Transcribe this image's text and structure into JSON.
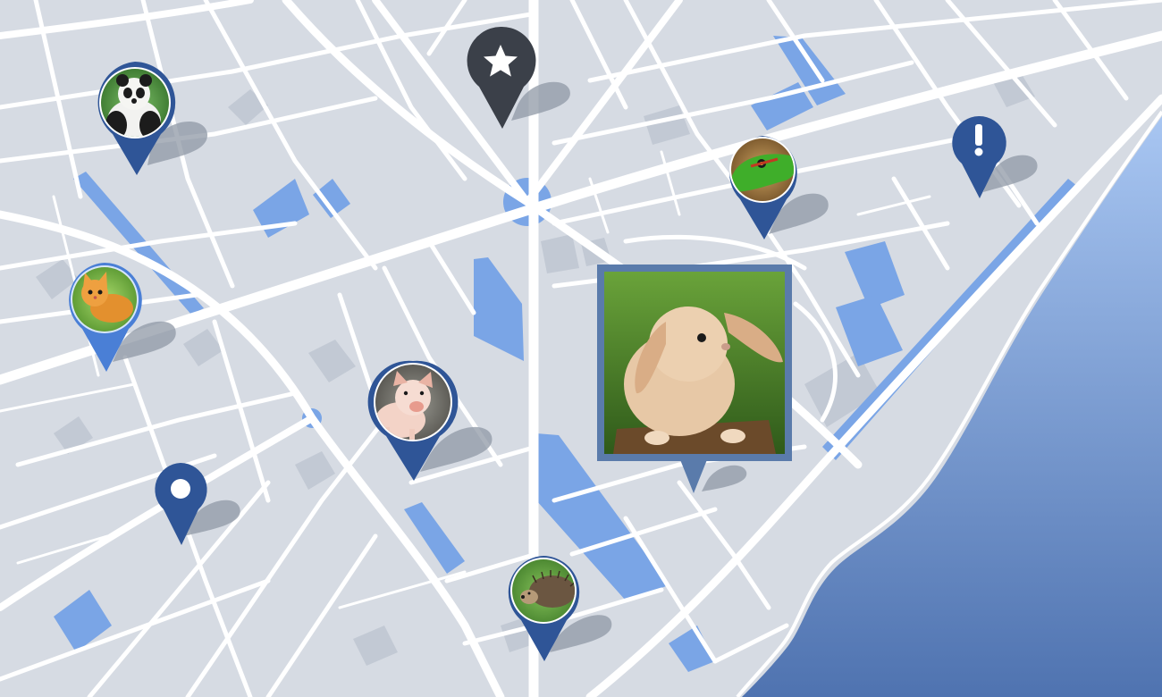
{
  "map": {
    "colors": {
      "land": "#d6dbe3",
      "road": "#ffffff",
      "park": "#7aa5e6",
      "building": "#c2c9d4",
      "sea_light": "#a8c6f2",
      "sea_dark": "#4f73b0",
      "pin_blue": "#2f5597",
      "pin_dark": "#3b4049"
    }
  },
  "markers": [
    {
      "id": "panda",
      "kind": "photo",
      "icon": "panda-photo-icon",
      "color": "#2f5597"
    },
    {
      "id": "star",
      "kind": "glyph",
      "icon": "star-icon",
      "color": "#3b4049"
    },
    {
      "id": "lizard",
      "kind": "photo",
      "icon": "lizard-photo-icon",
      "color": "#2f5597"
    },
    {
      "id": "alert",
      "kind": "glyph",
      "icon": "exclamation-icon",
      "color": "#2f5597"
    },
    {
      "id": "kitten",
      "kind": "photo",
      "icon": "kitten-photo-icon",
      "color": "#4a7fd6"
    },
    {
      "id": "pig",
      "kind": "photo",
      "icon": "pig-photo-icon",
      "color": "#2f5597"
    },
    {
      "id": "location",
      "kind": "glyph",
      "icon": "circle-dot-icon",
      "color": "#2f5597"
    },
    {
      "id": "hedgehog",
      "kind": "photo",
      "icon": "hedgehog-photo-icon",
      "color": "#2f5597"
    },
    {
      "id": "rabbit",
      "kind": "selected-photo",
      "icon": "rabbit-photo-icon",
      "color": "#5a7bab"
    }
  ]
}
